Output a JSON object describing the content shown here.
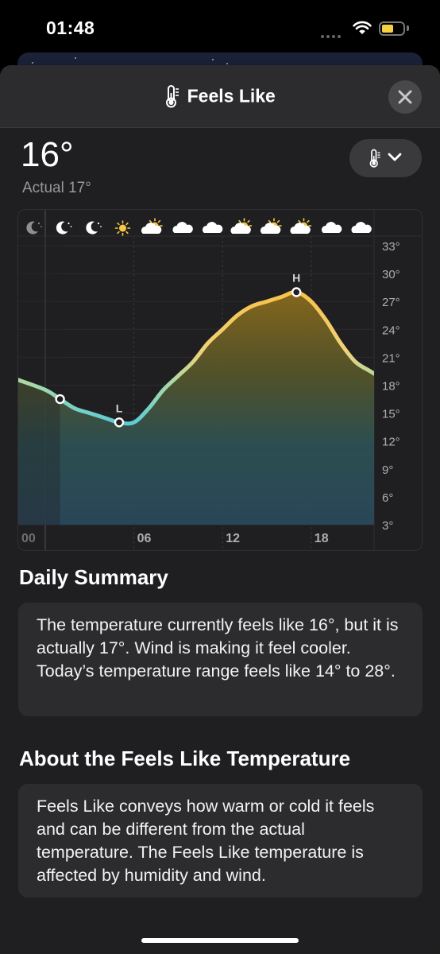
{
  "status_bar": {
    "time": "01:48"
  },
  "header": {
    "title": "Feels Like",
    "icon": "thermometer-icon"
  },
  "current": {
    "feels_like": "16°",
    "actual": "Actual 17°"
  },
  "picker": {
    "icon": "thermometer-icon",
    "chevron": "chevron-down-icon"
  },
  "chart_data": {
    "type": "line",
    "x": [
      0,
      1,
      2,
      3,
      4,
      5,
      6,
      7,
      8,
      9,
      10,
      11,
      12,
      13,
      14,
      15,
      16,
      17,
      18,
      19,
      20,
      21,
      22,
      23
    ],
    "series": [
      {
        "values": [
          17.5,
          16.5,
          15.5,
          15,
          14.5,
          14,
          14,
          15.5,
          17.5,
          19,
          20.5,
          22.5,
          24,
          25.5,
          26.5,
          27,
          27.5,
          28,
          27,
          25,
          22.5,
          20.5,
          19.5,
          18.5
        ]
      }
    ],
    "markers": [
      {
        "label": "",
        "x": 1,
        "y": 16.5
      },
      {
        "label": "L",
        "x": 5,
        "y": 14
      },
      {
        "label": "H",
        "x": 17,
        "y": 28
      }
    ],
    "x_tick_labels": [
      "00",
      "06",
      "12",
      "18"
    ],
    "y_tick_labels": [
      "33°",
      "30°",
      "27°",
      "24°",
      "21°",
      "18°",
      "15°",
      "12°",
      "9°",
      "6°",
      "3°"
    ],
    "ylim": [
      3,
      33
    ],
    "hour_icons": [
      "moon-partly-cloudy-icon",
      "moon-icon",
      "moon-icon",
      "sun-icon",
      "sun-cloud-icon",
      "cloud-icon",
      "cloud-icon",
      "sun-cloud-icon",
      "sun-cloud-icon",
      "sun-cloud-icon",
      "cloud-icon",
      "cloud-icon"
    ],
    "colors": {
      "cold": "#5fc6d0",
      "mild": "#a9dba0",
      "warm": "#f3c24b"
    }
  },
  "daily_summary": {
    "title": "Daily Summary",
    "text": "The temperature currently feels like 16°, but it is actually 17°. Wind is making it feel cooler. Today’s temperature range feels like 14° to 28°."
  },
  "about": {
    "title": "About the Feels Like Temperature",
    "text": "Feels Like conveys how warm or cold it feels and can be different from the actual temperature. The Feels Like temperature is affected by humidity and wind."
  }
}
